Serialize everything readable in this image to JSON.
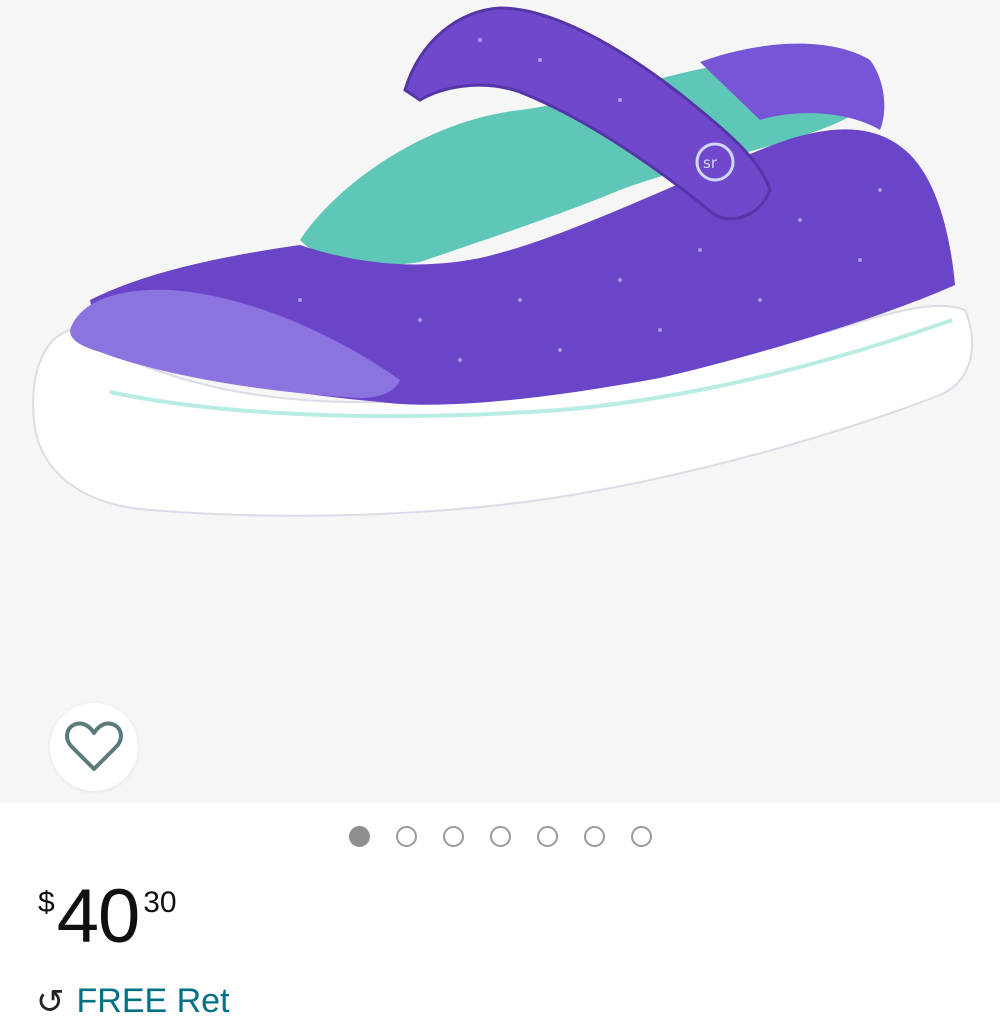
{
  "product": {
    "image_alt": "Purple shimmer mary jane sneaker with velcro strap"
  },
  "favorite": {
    "icon": "heart-outline-icon"
  },
  "carousel": {
    "total": 7,
    "active_index": 0
  },
  "price": {
    "currency": "$",
    "whole": "40",
    "fraction": "30"
  },
  "returns": {
    "icon": "return-icon",
    "label": "FREE Ret"
  }
}
